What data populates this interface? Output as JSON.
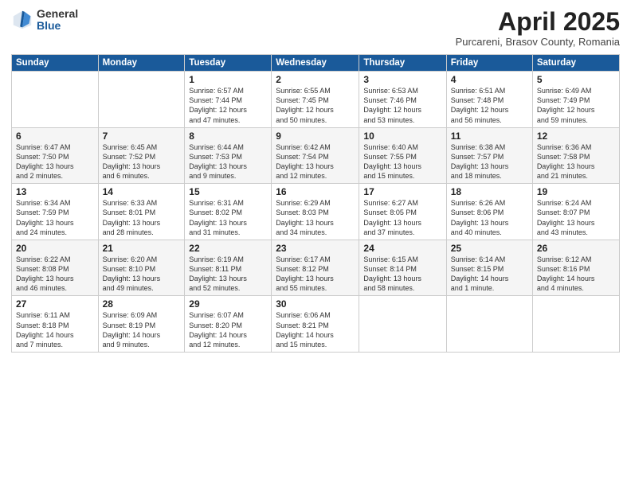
{
  "logo": {
    "general": "General",
    "blue": "Blue"
  },
  "header": {
    "month": "April 2025",
    "location": "Purcareni, Brasov County, Romania"
  },
  "weekdays": [
    "Sunday",
    "Monday",
    "Tuesday",
    "Wednesday",
    "Thursday",
    "Friday",
    "Saturday"
  ],
  "weeks": [
    [
      {
        "day": "",
        "info": ""
      },
      {
        "day": "",
        "info": ""
      },
      {
        "day": "1",
        "info": "Sunrise: 6:57 AM\nSunset: 7:44 PM\nDaylight: 12 hours\nand 47 minutes."
      },
      {
        "day": "2",
        "info": "Sunrise: 6:55 AM\nSunset: 7:45 PM\nDaylight: 12 hours\nand 50 minutes."
      },
      {
        "day": "3",
        "info": "Sunrise: 6:53 AM\nSunset: 7:46 PM\nDaylight: 12 hours\nand 53 minutes."
      },
      {
        "day": "4",
        "info": "Sunrise: 6:51 AM\nSunset: 7:48 PM\nDaylight: 12 hours\nand 56 minutes."
      },
      {
        "day": "5",
        "info": "Sunrise: 6:49 AM\nSunset: 7:49 PM\nDaylight: 12 hours\nand 59 minutes."
      }
    ],
    [
      {
        "day": "6",
        "info": "Sunrise: 6:47 AM\nSunset: 7:50 PM\nDaylight: 13 hours\nand 2 minutes."
      },
      {
        "day": "7",
        "info": "Sunrise: 6:45 AM\nSunset: 7:52 PM\nDaylight: 13 hours\nand 6 minutes."
      },
      {
        "day": "8",
        "info": "Sunrise: 6:44 AM\nSunset: 7:53 PM\nDaylight: 13 hours\nand 9 minutes."
      },
      {
        "day": "9",
        "info": "Sunrise: 6:42 AM\nSunset: 7:54 PM\nDaylight: 13 hours\nand 12 minutes."
      },
      {
        "day": "10",
        "info": "Sunrise: 6:40 AM\nSunset: 7:55 PM\nDaylight: 13 hours\nand 15 minutes."
      },
      {
        "day": "11",
        "info": "Sunrise: 6:38 AM\nSunset: 7:57 PM\nDaylight: 13 hours\nand 18 minutes."
      },
      {
        "day": "12",
        "info": "Sunrise: 6:36 AM\nSunset: 7:58 PM\nDaylight: 13 hours\nand 21 minutes."
      }
    ],
    [
      {
        "day": "13",
        "info": "Sunrise: 6:34 AM\nSunset: 7:59 PM\nDaylight: 13 hours\nand 24 minutes."
      },
      {
        "day": "14",
        "info": "Sunrise: 6:33 AM\nSunset: 8:01 PM\nDaylight: 13 hours\nand 28 minutes."
      },
      {
        "day": "15",
        "info": "Sunrise: 6:31 AM\nSunset: 8:02 PM\nDaylight: 13 hours\nand 31 minutes."
      },
      {
        "day": "16",
        "info": "Sunrise: 6:29 AM\nSunset: 8:03 PM\nDaylight: 13 hours\nand 34 minutes."
      },
      {
        "day": "17",
        "info": "Sunrise: 6:27 AM\nSunset: 8:05 PM\nDaylight: 13 hours\nand 37 minutes."
      },
      {
        "day": "18",
        "info": "Sunrise: 6:26 AM\nSunset: 8:06 PM\nDaylight: 13 hours\nand 40 minutes."
      },
      {
        "day": "19",
        "info": "Sunrise: 6:24 AM\nSunset: 8:07 PM\nDaylight: 13 hours\nand 43 minutes."
      }
    ],
    [
      {
        "day": "20",
        "info": "Sunrise: 6:22 AM\nSunset: 8:08 PM\nDaylight: 13 hours\nand 46 minutes."
      },
      {
        "day": "21",
        "info": "Sunrise: 6:20 AM\nSunset: 8:10 PM\nDaylight: 13 hours\nand 49 minutes."
      },
      {
        "day": "22",
        "info": "Sunrise: 6:19 AM\nSunset: 8:11 PM\nDaylight: 13 hours\nand 52 minutes."
      },
      {
        "day": "23",
        "info": "Sunrise: 6:17 AM\nSunset: 8:12 PM\nDaylight: 13 hours\nand 55 minutes."
      },
      {
        "day": "24",
        "info": "Sunrise: 6:15 AM\nSunset: 8:14 PM\nDaylight: 13 hours\nand 58 minutes."
      },
      {
        "day": "25",
        "info": "Sunrise: 6:14 AM\nSunset: 8:15 PM\nDaylight: 14 hours\nand 1 minute."
      },
      {
        "day": "26",
        "info": "Sunrise: 6:12 AM\nSunset: 8:16 PM\nDaylight: 14 hours\nand 4 minutes."
      }
    ],
    [
      {
        "day": "27",
        "info": "Sunrise: 6:11 AM\nSunset: 8:18 PM\nDaylight: 14 hours\nand 7 minutes."
      },
      {
        "day": "28",
        "info": "Sunrise: 6:09 AM\nSunset: 8:19 PM\nDaylight: 14 hours\nand 9 minutes."
      },
      {
        "day": "29",
        "info": "Sunrise: 6:07 AM\nSunset: 8:20 PM\nDaylight: 14 hours\nand 12 minutes."
      },
      {
        "day": "30",
        "info": "Sunrise: 6:06 AM\nSunset: 8:21 PM\nDaylight: 14 hours\nand 15 minutes."
      },
      {
        "day": "",
        "info": ""
      },
      {
        "day": "",
        "info": ""
      },
      {
        "day": "",
        "info": ""
      }
    ]
  ]
}
